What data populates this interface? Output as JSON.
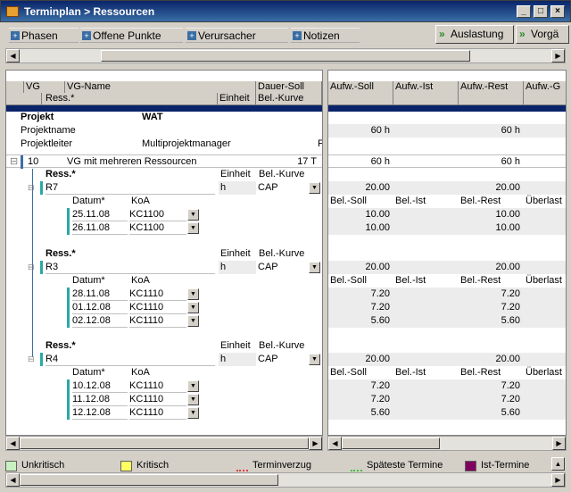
{
  "window": {
    "title": "Terminplan > Ressourcen"
  },
  "toolbar": {
    "phasen": "Phasen",
    "offene_punkte": "Offene Punkte",
    "verursacher": "Verursacher",
    "notizen": "Notizen",
    "auslastung": "Auslastung",
    "vorgaenge": "Vorgä"
  },
  "left_header": {
    "vg": "VG",
    "vg_name": "VG-Name",
    "dauer_soll": "Dauer-Soll",
    "ress": "Ress.*",
    "einheit": "Einheit",
    "bel_kurve": "Bel.-Kurve"
  },
  "right_header": {
    "c1": "Aufw.-Soll",
    "c2": "Aufw.-Ist",
    "c3": "Aufw.-Rest",
    "c4": "Aufw.-G"
  },
  "project": {
    "label": "Projekt",
    "value": "WAT",
    "name_label": "Projektname",
    "name_value": "",
    "leiter_label": "Projektleiter",
    "leiter_value": "Multiprojektmanager",
    "leiter_tail": "P",
    "aufw_soll": "60 h",
    "aufw_rest": "60 h"
  },
  "task": {
    "id": "10",
    "name": "VG mit mehreren Ressourcen",
    "dauer": "17 T",
    "aufw_soll": "60 h",
    "aufw_rest": "60 h"
  },
  "res_header": {
    "ress": "Ress.*",
    "einheit": "Einheit",
    "bel_kurve": "Bel.-Kurve"
  },
  "sub_header": {
    "datum": "Datum*",
    "koa": "KoA"
  },
  "right_sub_header": {
    "c1": "Bel.-Soll",
    "c2": "Bel.-Ist",
    "c3": "Bel.-Rest",
    "c4": "Überlast"
  },
  "resources": [
    {
      "name": "R7",
      "einheit": "h",
      "kurve": "CAP",
      "soll": "20.00",
      "rest": "20.00",
      "rows": [
        {
          "datum": "25.11.08",
          "koa": "KC1100",
          "soll": "10.00",
          "rest": "10.00"
        },
        {
          "datum": "26.11.08",
          "koa": "KC1100",
          "soll": "10.00",
          "rest": "10.00"
        }
      ]
    },
    {
      "name": "R3",
      "einheit": "h",
      "kurve": "CAP",
      "soll": "20.00",
      "rest": "20.00",
      "rows": [
        {
          "datum": "28.11.08",
          "koa": "KC1110",
          "soll": "7.20",
          "rest": "7.20"
        },
        {
          "datum": "01.12.08",
          "koa": "KC1110",
          "soll": "7.20",
          "rest": "7.20"
        },
        {
          "datum": "02.12.08",
          "koa": "KC1110",
          "soll": "5.60",
          "rest": "5.60"
        }
      ]
    },
    {
      "name": "R4",
      "einheit": "h",
      "kurve": "CAP",
      "soll": "20.00",
      "rest": "20.00",
      "rows": [
        {
          "datum": "10.12.08",
          "koa": "KC1110",
          "soll": "7.20",
          "rest": "7.20"
        },
        {
          "datum": "11.12.08",
          "koa": "KC1110",
          "soll": "7.20",
          "rest": "7.20"
        },
        {
          "datum": "12.12.08",
          "koa": "KC1110",
          "soll": "5.60",
          "rest": "5.60"
        }
      ]
    }
  ],
  "legend": [
    {
      "label": "Unkritisch",
      "color": "#c8f0c0"
    },
    {
      "label": "Kritisch",
      "color": "#ffff60"
    },
    {
      "label": "Terminverzug",
      "color": "#e04040"
    },
    {
      "label": "Späteste Termine",
      "color": "#40c040"
    },
    {
      "label": "Ist-Termine",
      "color": "#800060"
    }
  ]
}
